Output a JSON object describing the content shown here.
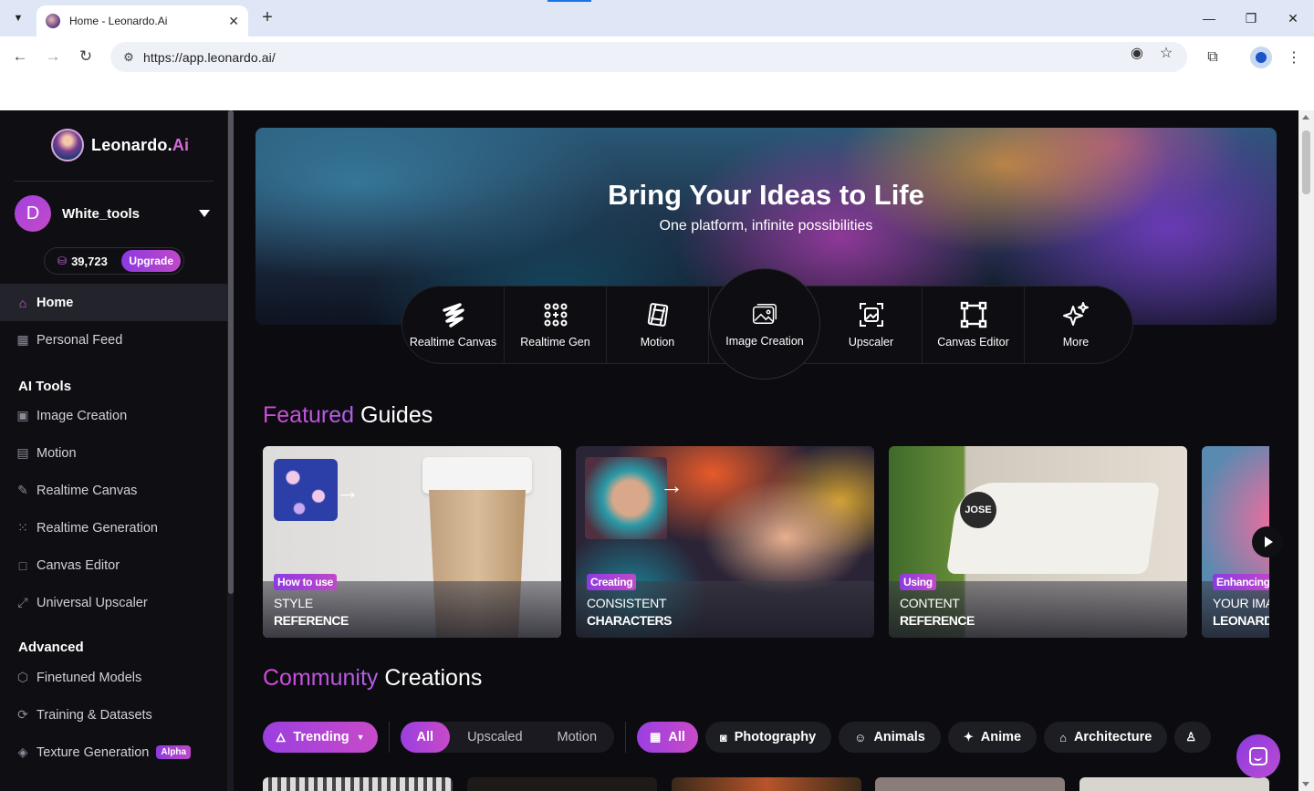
{
  "browser": {
    "tab_title": "Home - Leonardo.Ai",
    "tab_close": "✕",
    "new_tab": "+",
    "url": "https://app.leonardo.ai/"
  },
  "sidebar": {
    "logo_text": "Leonardo.",
    "logo_ai": "Ai",
    "user": {
      "initial": "D",
      "name": "White_tools"
    },
    "credits": {
      "count": "39,723",
      "upgrade": "Upgrade"
    },
    "items": [
      {
        "label": "Home",
        "icon": "home-icon",
        "active": true
      },
      {
        "label": "Personal Feed",
        "icon": "grid-icon"
      }
    ],
    "ai_tools_label": "AI Tools",
    "ai_tools": [
      {
        "label": "Image Creation",
        "icon": "image-icon"
      },
      {
        "label": "Motion",
        "icon": "film-icon"
      },
      {
        "label": "Realtime Canvas",
        "icon": "brush-icon"
      },
      {
        "label": "Realtime Generation",
        "icon": "dots-grid-icon"
      },
      {
        "label": "Canvas Editor",
        "icon": "crop-square-icon"
      },
      {
        "label": "Universal Upscaler",
        "icon": "upscale-icon"
      }
    ],
    "advanced_label": "Advanced",
    "advanced": [
      {
        "label": "Finetuned Models",
        "icon": "cube-icon"
      },
      {
        "label": "Training & Datasets",
        "icon": "dataset-icon"
      },
      {
        "label": "Texture Generation",
        "icon": "texture-icon",
        "badge": "Alpha"
      }
    ]
  },
  "hero": {
    "title": "Bring Your Ideas to Life",
    "subtitle": "One platform, infinite possibilities"
  },
  "tools": [
    {
      "label": "Realtime Canvas",
      "icon": "brush-icon"
    },
    {
      "label": "Realtime Gen",
      "icon": "dots-grid-icon"
    },
    {
      "label": "Motion",
      "icon": "film-icon"
    },
    {
      "label": "Image Creation",
      "icon": "image-icon",
      "featured": true
    },
    {
      "label": "Upscaler",
      "icon": "upscale-icon"
    },
    {
      "label": "Canvas Editor",
      "icon": "crop-square-icon"
    },
    {
      "label": "More",
      "icon": "sparkles-icon"
    }
  ],
  "featured_guides": {
    "accent": "Featured",
    "rest": " Guides",
    "cards": [
      {
        "badge": "How to use",
        "line1": "STYLE",
        "line2": "REFERENCE"
      },
      {
        "badge": "Creating",
        "line1": "CONSISTENT",
        "line2": "CHARACTERS"
      },
      {
        "badge": "Using",
        "line1": "CONTENT",
        "line2": "REFERENCE"
      },
      {
        "badge": "Enhancing",
        "line1": "YOUR IMA",
        "line2": "LEONARD"
      }
    ]
  },
  "community": {
    "accent": "Community",
    "rest": " Creations",
    "sort": "Trending",
    "type_tabs": [
      "All",
      "Upscaled",
      "Motion"
    ],
    "categories": [
      {
        "label": "All",
        "icon": "grid-icon"
      },
      {
        "label": "Photography",
        "icon": "camera-icon"
      },
      {
        "label": "Animals",
        "icon": "cat-icon"
      },
      {
        "label": "Anime",
        "icon": "sparkle-icon"
      },
      {
        "label": "Architecture",
        "icon": "building-icon"
      }
    ]
  },
  "colors": {
    "accent_gradient_start": "#8c3ae0",
    "accent_gradient_end": "#c048c9",
    "sidebar_bg": "#0e0e13",
    "main_bg": "#0b0b10"
  }
}
